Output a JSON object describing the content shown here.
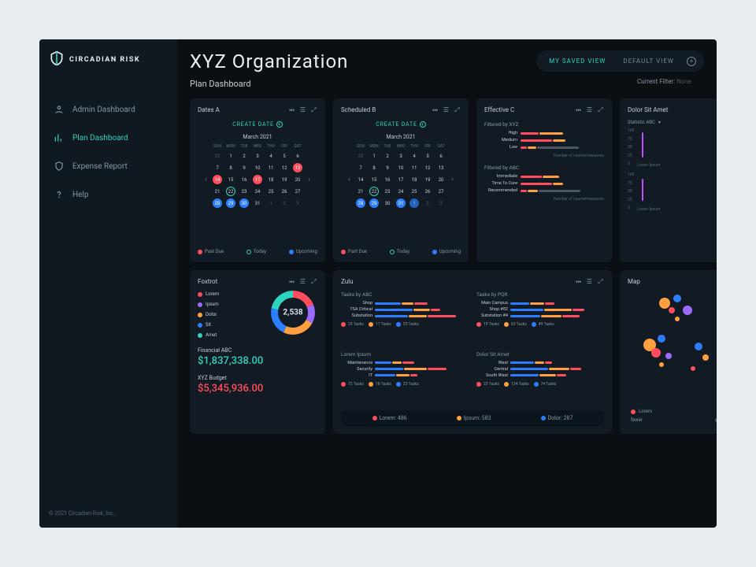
{
  "brand": {
    "name": "CIRCADIAN RISK"
  },
  "nav": {
    "items": [
      {
        "label": "Admin Dashboard"
      },
      {
        "label": "Plan Dashboard"
      },
      {
        "label": "Expense Report"
      },
      {
        "label": "Help"
      }
    ]
  },
  "copyright": "© 2021 Circadian Risk, Inc.",
  "header": {
    "title": "XYZ Organization",
    "subtitle": "Plan Dashboard",
    "tabs": {
      "saved": "MY SAVED VIEW",
      "default": "DEFAULT VIEW"
    },
    "filter_label": "Current Filter:",
    "filter_value": "None"
  },
  "cards": {
    "datesA": {
      "title": "Dates A",
      "create": "CREATE DATE",
      "month": "March 2021",
      "dow": [
        "SUN",
        "MON",
        "TUE",
        "WED",
        "THU",
        "FRI",
        "SAT"
      ],
      "legend": {
        "past": "Past Due",
        "today": "Today",
        "upcoming": "Upcoming"
      }
    },
    "scheduledB": {
      "title": "Scheduled B",
      "create": "CREATE DATE",
      "month": "March 2021"
    },
    "effectiveC": {
      "title": "Effective C",
      "section1": "Filtered by XYZ",
      "rows1": [
        "High",
        "Medium",
        "Low"
      ],
      "section2": "Filtered by ABC",
      "rows2": [
        "Immediate",
        "Time To Cure",
        "Recommended"
      ],
      "axis": "Number of countermeasures"
    },
    "dolor": {
      "title": "Dolor Sit Amet",
      "stat": "Statistic ABC",
      "yticks": [
        "100",
        "75",
        "50",
        "25",
        "0"
      ],
      "xcap": "Lorem Ipsum"
    },
    "foxtrot": {
      "title": "Foxtrot",
      "legend": [
        "Lorem",
        "Ipsum",
        "Dolor",
        "Sit",
        "Amet"
      ],
      "colors": [
        "#ff4d5e",
        "#9b6bff",
        "#ff9f40",
        "#2b7fff",
        "#2dd4bf"
      ],
      "center": "2,538",
      "fin_label": "Financial ABC",
      "fin_value": "$1,837,338.00",
      "budget_label": "XYZ Budget",
      "budget_value": "$5,345,936.00"
    },
    "zulu": {
      "title": "Zulu",
      "q1": {
        "title": "Tasks by ABC",
        "rows": [
          "Shop",
          "TSA Critical",
          "Substation"
        ],
        "legend": [
          "25 Tasks",
          "11 Tasks",
          "33 Tasks"
        ]
      },
      "q2": {
        "title": "Tasks by PQR",
        "rows": [
          "Main Campus",
          "Shop #82",
          "Substation #4"
        ],
        "legend": [
          "19 Tasks",
          "63 Tasks",
          "49 Tasks"
        ]
      },
      "q3": {
        "title": "Lorem Ipsum",
        "rows": [
          "Maintenance",
          "Security",
          "IT"
        ],
        "legend": [
          "72 Tasks",
          "18 Tasks",
          "23 Tasks"
        ]
      },
      "q4": {
        "title": "Dolor Sit Amet",
        "rows": [
          "West",
          "Central",
          "South West"
        ],
        "legend": [
          "23 Tasks",
          "124 Tasks",
          "74 Tasks"
        ]
      },
      "totals": {
        "lorem": "Lorem: 486",
        "ipsum": "Ipsum: 583",
        "dolor": "Dolor: 287"
      }
    },
    "map": {
      "title": "Map",
      "legend_items": "Lorem",
      "fewer": "fewer"
    }
  },
  "chart_data": [
    {
      "id": "effectiveC_xyz",
      "type": "bar",
      "orientation": "horizontal",
      "title": "Filtered by XYZ",
      "xlabel": "Number of countermeasures",
      "categories": [
        "High",
        "Medium",
        "Low"
      ],
      "series": [
        {
          "name": "red",
          "color": "#ff4d5e",
          "values": [
            18,
            30,
            5
          ]
        },
        {
          "name": "orange",
          "color": "#ff9f40",
          "values": [
            22,
            12,
            8
          ]
        },
        {
          "name": "grey",
          "color": "#4a545e",
          "values": [
            0,
            0,
            40
          ]
        }
      ]
    },
    {
      "id": "effectiveC_abc",
      "type": "bar",
      "orientation": "horizontal",
      "title": "Filtered by ABC",
      "xlabel": "Number of countermeasures",
      "categories": [
        "Immediate",
        "Time To Cure",
        "Recommended"
      ],
      "series": [
        {
          "name": "red",
          "color": "#ff4d5e",
          "values": [
            20,
            30,
            5
          ]
        },
        {
          "name": "orange",
          "color": "#ff9f40",
          "values": [
            15,
            10,
            10
          ]
        },
        {
          "name": "grey",
          "color": "#4a545e",
          "values": [
            0,
            0,
            40
          ]
        }
      ]
    },
    {
      "id": "dolor_top",
      "type": "bar",
      "categories": [
        "Lorem Ipsum"
      ],
      "values": [
        60
      ],
      "ylim": [
        0,
        100
      ],
      "yticks": [
        0,
        25,
        50,
        75,
        100
      ],
      "title": "Statistic ABC"
    },
    {
      "id": "dolor_bottom",
      "type": "bar",
      "categories": [
        "Lorem Ipsum"
      ],
      "values": [
        55
      ],
      "ylim": [
        0,
        100
      ],
      "yticks": [
        0,
        25,
        50,
        75,
        100
      ]
    },
    {
      "id": "foxtrot_donut",
      "type": "pie",
      "title": "Foxtrot",
      "total": 2538,
      "series": [
        {
          "name": "Lorem",
          "color": "#ff4d5e",
          "value": 480
        },
        {
          "name": "Ipsum",
          "color": "#9b6bff",
          "value": 360
        },
        {
          "name": "Dolor",
          "color": "#ff9f40",
          "value": 620
        },
        {
          "name": "Sit",
          "color": "#2b7fff",
          "value": 540
        },
        {
          "name": "Amet",
          "color": "#2dd4bf",
          "value": 538
        }
      ]
    },
    {
      "id": "zulu_abc",
      "type": "bar",
      "orientation": "horizontal",
      "title": "Tasks by ABC",
      "categories": [
        "Shop",
        "TSA Critical",
        "Substation"
      ],
      "series": [
        {
          "name": "red",
          "color": "#ff4d5e",
          "values": [
            25,
            25,
            25
          ]
        },
        {
          "name": "orange",
          "color": "#ff9f40",
          "values": [
            11,
            11,
            11
          ]
        },
        {
          "name": "blue",
          "color": "#2b7fff",
          "values": [
            33,
            20,
            45
          ]
        }
      ]
    },
    {
      "id": "zulu_pqr",
      "type": "bar",
      "orientation": "horizontal",
      "title": "Tasks by PQR",
      "categories": [
        "Main Campus",
        "Shop #82",
        "Substation #4"
      ],
      "series": [
        {
          "name": "red",
          "color": "#ff4d5e",
          "values": [
            19,
            19,
            19
          ]
        },
        {
          "name": "orange",
          "color": "#ff9f40",
          "values": [
            63,
            40,
            50
          ]
        },
        {
          "name": "blue",
          "color": "#2b7fff",
          "values": [
            49,
            30,
            20
          ]
        }
      ]
    },
    {
      "id": "zulu_lorem",
      "type": "bar",
      "orientation": "horizontal",
      "title": "Lorem Ipsum",
      "categories": [
        "Maintenance",
        "Security",
        "IT"
      ],
      "series": [
        {
          "name": "red",
          "color": "#ff4d5e",
          "values": [
            72,
            40,
            20
          ]
        },
        {
          "name": "orange",
          "color": "#ff9f40",
          "values": [
            18,
            18,
            18
          ]
        },
        {
          "name": "blue",
          "color": "#2b7fff",
          "values": [
            23,
            30,
            35
          ]
        }
      ]
    },
    {
      "id": "zulu_dolor",
      "type": "bar",
      "orientation": "horizontal",
      "title": "Dolor Sit Amet",
      "categories": [
        "West",
        "Central",
        "South West"
      ],
      "series": [
        {
          "name": "red",
          "color": "#ff4d5e",
          "values": [
            23,
            23,
            23
          ]
        },
        {
          "name": "orange",
          "color": "#ff9f40",
          "values": [
            124,
            80,
            60
          ]
        },
        {
          "name": "blue",
          "color": "#2b7fff",
          "values": [
            74,
            50,
            40
          ]
        }
      ]
    },
    {
      "id": "zulu_totals",
      "type": "table",
      "series": [
        {
          "name": "Lorem",
          "color": "#ff4d5e",
          "value": 486
        },
        {
          "name": "Ipsum",
          "color": "#ff9f40",
          "value": 583
        },
        {
          "name": "Dolor",
          "color": "#2b7fff",
          "value": 287
        }
      ]
    }
  ]
}
